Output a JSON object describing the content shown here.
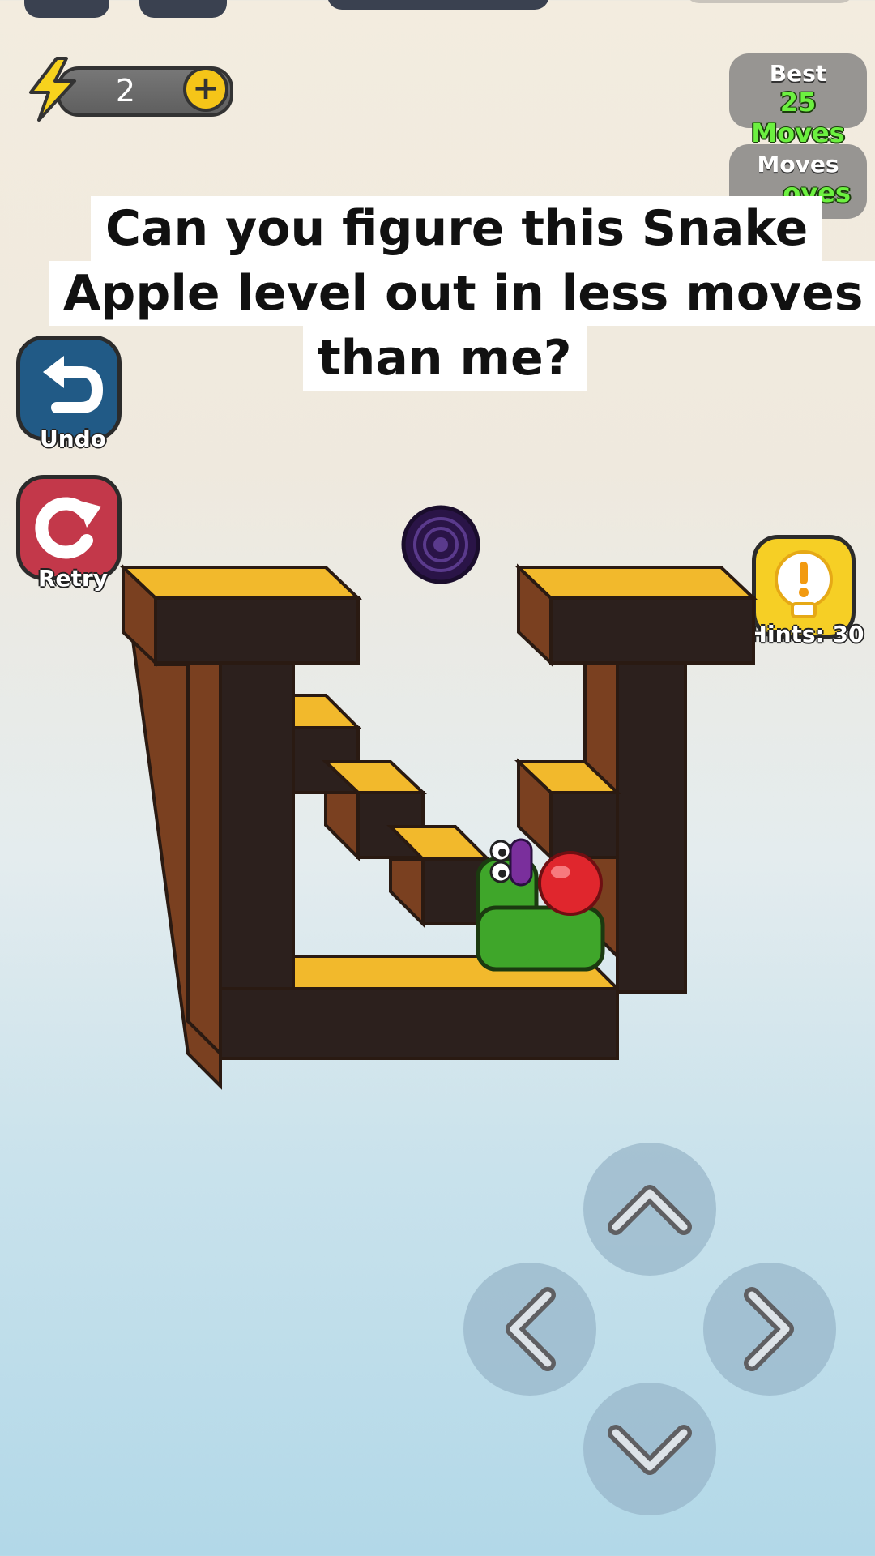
{
  "energy": {
    "count": "2",
    "plus_symbol": "+"
  },
  "stats": {
    "best_label": "Best",
    "best_value": "25 Moves",
    "moves_label": "Moves",
    "moves_value_partial": "oves"
  },
  "caption": {
    "line1": "Can you figure this Snake",
    "line2": "Apple level out in less moves",
    "line3": "than me?"
  },
  "controls": {
    "undo_label": "Undo",
    "retry_label": "Retry",
    "hints_label": "Hints: 30"
  },
  "dpad": {
    "up_icon": "chevron-up-icon",
    "left_icon": "chevron-left-icon",
    "right_icon": "chevron-right-icon",
    "down_icon": "chevron-down-icon"
  },
  "colors": {
    "wall_top": "#f2b92c",
    "wall_dark": "#2c201d",
    "wall_side": "#7a4020",
    "snake": "#3fa62a",
    "apple": "#e0262d",
    "portal": "#3a1e5c",
    "moves_green": "#6cf040"
  }
}
